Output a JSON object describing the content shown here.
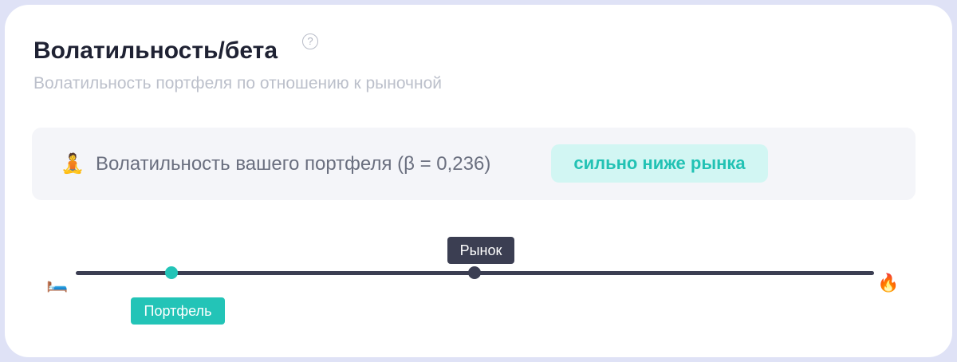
{
  "widget": {
    "title": "Волатильность/бета",
    "help_icon": "question-circle-icon",
    "subtitle": "Волатильность портфеля по отношению к рыночной"
  },
  "summary": {
    "emoji": "🧘",
    "text": "Волатильность вашего портфеля (β = 0,236)",
    "beta_value": 0.236,
    "badge": "сильно ниже рынка",
    "badge_color": "#22c2b4"
  },
  "scale": {
    "low_end_emoji": "🛏️",
    "high_end_emoji": "🔥",
    "market_label": "Рынок",
    "portfolio_label": "Портфель",
    "portfolio_position": 0.12,
    "market_position": 0.5,
    "track_color": "#3b3e52",
    "portfolio_color": "#23c4b7"
  }
}
